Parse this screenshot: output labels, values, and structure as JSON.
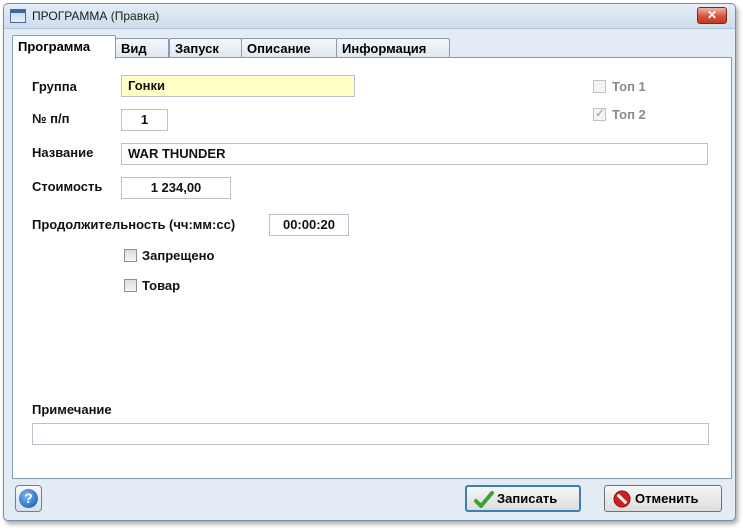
{
  "window": {
    "title": "ПРОГРАММА (Правка)",
    "close_label": "✕"
  },
  "tabs": [
    {
      "label": "Программа",
      "active": true
    },
    {
      "label": "Вид",
      "active": false
    },
    {
      "label": "Запуск",
      "active": false
    },
    {
      "label": "Описание",
      "active": false
    },
    {
      "label": "Информация",
      "active": false
    }
  ],
  "form": {
    "group_label": "Группа",
    "group_value": "Гонки",
    "number_label": "№ п/п",
    "number_value": "1",
    "name_label": "Название",
    "name_value": "WAR THUNDER",
    "cost_label": "Стоимость",
    "cost_value": "1 234,00",
    "duration_label": "Продолжительность (чч:мм:сс)",
    "duration_value": "00:00:20",
    "forbidden_label": "Запрещено",
    "forbidden_checked": false,
    "goods_label": "Товар",
    "goods_checked": false,
    "top1_label": "Топ 1",
    "top1_checked": false,
    "top2_label": "Топ 2",
    "top2_checked": true,
    "note_label": "Примечание",
    "note_value": ""
  },
  "buttons": {
    "help_label": "?",
    "save_label": "Записать",
    "cancel_label": "Отменить"
  },
  "colors": {
    "highlight_field": "#ffffc6",
    "save_icon": "#3aa52b",
    "cancel_icon": "#d02020"
  }
}
